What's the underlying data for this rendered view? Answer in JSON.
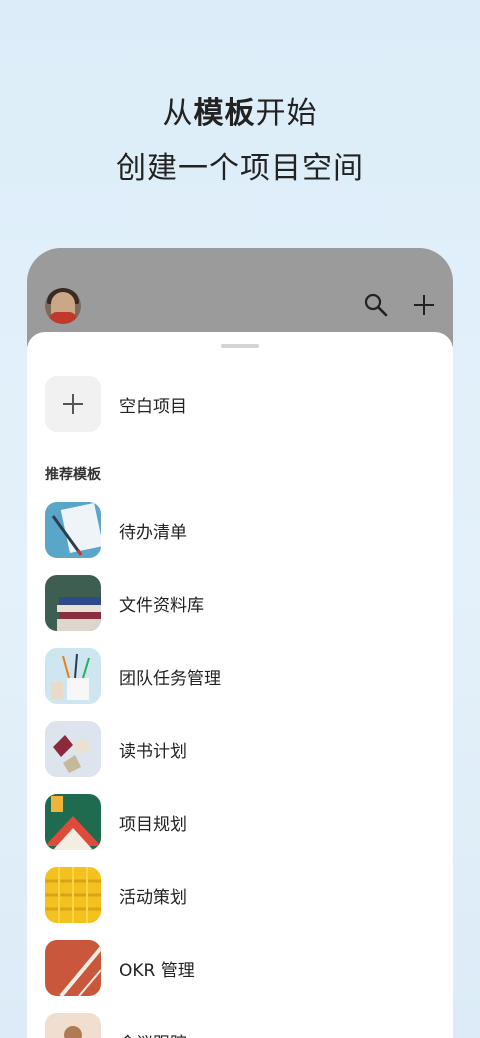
{
  "headline": {
    "prefix": "从",
    "bold": "模板",
    "suffix": "开始"
  },
  "subline": "创建一个项目空间",
  "blank_project": {
    "label": "空白项目"
  },
  "section_title": "推荐模板",
  "templates": [
    {
      "label": "待办清单",
      "icon": "pen-notebook-thumb"
    },
    {
      "label": "文件资料库",
      "icon": "book-stack-thumb"
    },
    {
      "label": "团队任务管理",
      "icon": "pencil-cup-thumb"
    },
    {
      "label": "读书计划",
      "icon": "open-books-thumb"
    },
    {
      "label": "项目规划",
      "icon": "roof-graphic-thumb"
    },
    {
      "label": "活动策划",
      "icon": "yellow-pattern-thumb"
    },
    {
      "label": "OKR 管理",
      "icon": "running-track-thumb"
    },
    {
      "label": "会议跟踪",
      "icon": "person-thumb"
    }
  ],
  "colors": {
    "background": "#dcedf9",
    "header_gray": "#9b9b9b",
    "sheet": "#ffffff"
  }
}
